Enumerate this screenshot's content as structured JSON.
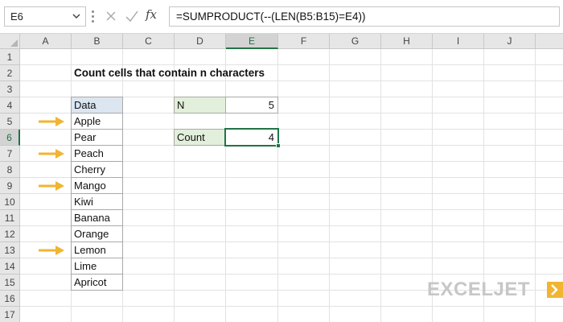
{
  "name_box": {
    "value": "E6"
  },
  "formula_bar": {
    "formula": "=SUMPRODUCT(--(LEN(B5:B15)=E4))",
    "fx_label": "fx"
  },
  "columns": [
    "A",
    "B",
    "C",
    "D",
    "E",
    "F",
    "G",
    "H",
    "I",
    "J"
  ],
  "rows": [
    "1",
    "2",
    "3",
    "4",
    "5",
    "6",
    "7",
    "8",
    "9",
    "10",
    "11",
    "12",
    "13",
    "14",
    "15",
    "16",
    "17"
  ],
  "active_cell": {
    "column": "E",
    "row": "6"
  },
  "sheet": {
    "title": "Count cells that contain n characters",
    "data_header": "Data",
    "data_values": [
      "Apple",
      "Pear",
      "Peach",
      "Cherry",
      "Mango",
      "Kiwi",
      "Banana",
      "Orange",
      "Lemon",
      "Lime",
      "Apricot"
    ],
    "n_label": "N",
    "n_value": "5",
    "count_label": "Count",
    "count_value": "4"
  },
  "highlighted_rows": [
    "5",
    "7",
    "9",
    "13"
  ],
  "colors": {
    "arrow": "#f1b531",
    "header_fill": "#dce6f1",
    "label_fill": "#e2efda",
    "selection": "#217346",
    "logo": "#c7c7c7",
    "logo_mark": "#f1b531"
  },
  "logo": {
    "text": "EXCELJET"
  }
}
